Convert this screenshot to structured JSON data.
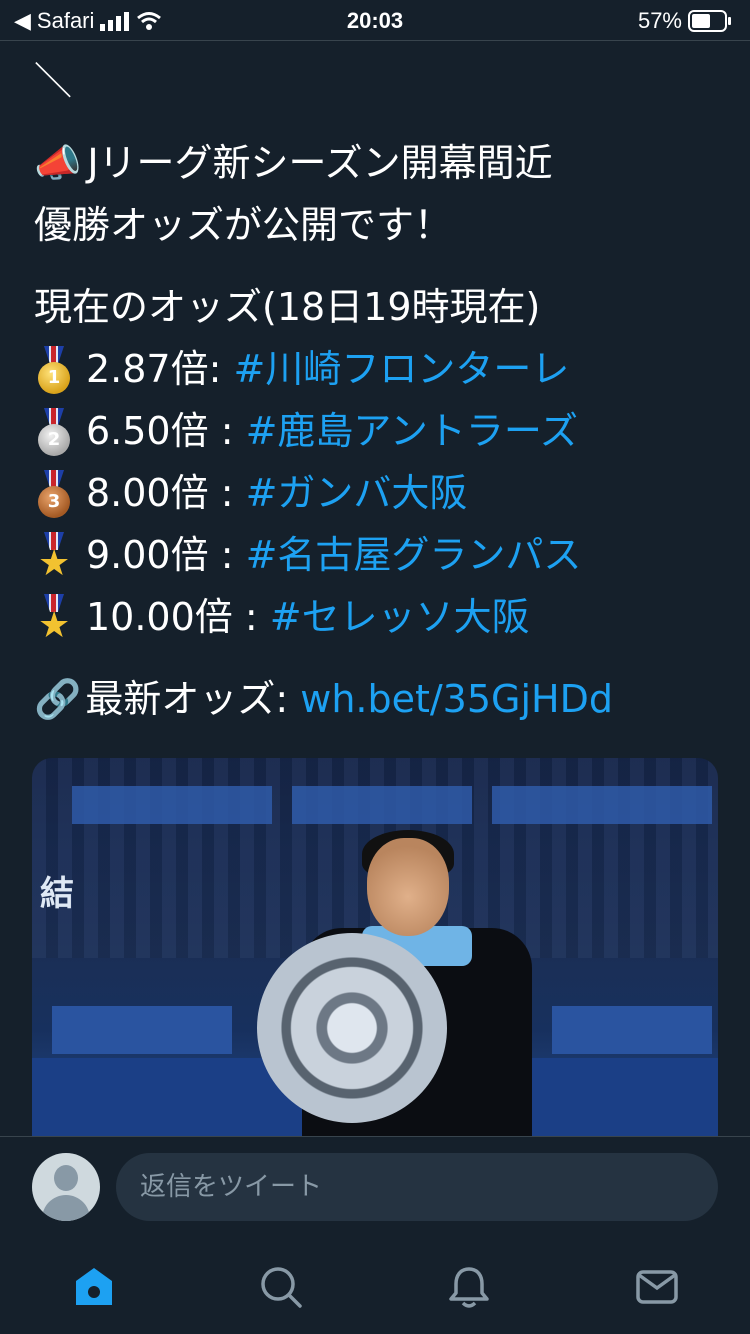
{
  "status_bar": {
    "back_app": "Safari",
    "time": "20:03",
    "battery": "57%"
  },
  "tweet": {
    "slash": "＼",
    "lines": [
      "Jリーグ新シーズン開幕間近",
      "優勝オッズが公開です！"
    ],
    "odds_title": "現在のオッズ(18日19時現在)",
    "odds": [
      {
        "medal": "1",
        "odds": "2.87倍:",
        "team": "#川崎フロンターレ"
      },
      {
        "medal": "2",
        "odds": "6.50倍 :",
        "team": "#鹿島アントラーズ"
      },
      {
        "medal": "3",
        "odds": "8.00倍 :",
        "team": "#ガンバ大阪"
      },
      {
        "medal": "★",
        "odds": "9.00倍 :",
        "team": "#名古屋グランパス"
      },
      {
        "medal": "★",
        "odds": "10.00倍 :",
        "team": "#セレッソ大阪"
      }
    ],
    "latest_label": "最新オッズ:",
    "latest_link": "wh.bet/35GjHDd"
  },
  "photo": {
    "banner_text": "結"
  },
  "reply": {
    "placeholder": "返信をツイート"
  },
  "tabs": [
    "home-icon",
    "search-icon",
    "notifications-icon",
    "messages-icon"
  ],
  "colors": {
    "background": "#15202b",
    "link": "#1da1f2",
    "divider": "#38444d"
  }
}
